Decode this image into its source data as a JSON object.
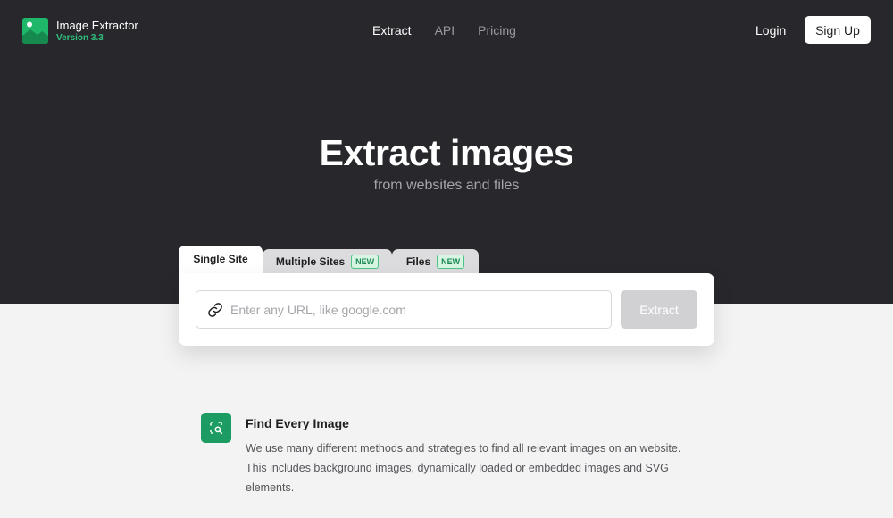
{
  "brand": {
    "name": "Image Extractor",
    "version": "Version 3.3",
    "logo_icon": "image-logo-icon",
    "accent_color": "#1fb86a"
  },
  "nav": {
    "links": [
      {
        "label": "Extract",
        "active": true
      },
      {
        "label": "API",
        "active": false
      },
      {
        "label": "Pricing",
        "active": false
      }
    ],
    "login_label": "Login",
    "signup_label": "Sign Up"
  },
  "hero": {
    "title": "Extract images",
    "subtitle": "from websites and files"
  },
  "tabs": [
    {
      "label": "Single Site",
      "active": true,
      "badge": ""
    },
    {
      "label": "Multiple Sites",
      "active": false,
      "badge": "NEW"
    },
    {
      "label": "Files",
      "active": false,
      "badge": "NEW"
    }
  ],
  "search": {
    "placeholder": "Enter any URL, like google.com",
    "value": "",
    "icon": "link-icon",
    "button_label": "Extract"
  },
  "features": [
    {
      "icon": "image-search-icon",
      "title": "Find Every Image",
      "description": "We use many different methods and strategies to find all relevant images on an website. This includes background images, dynamically loaded or embedded images and SVG elements."
    }
  ]
}
